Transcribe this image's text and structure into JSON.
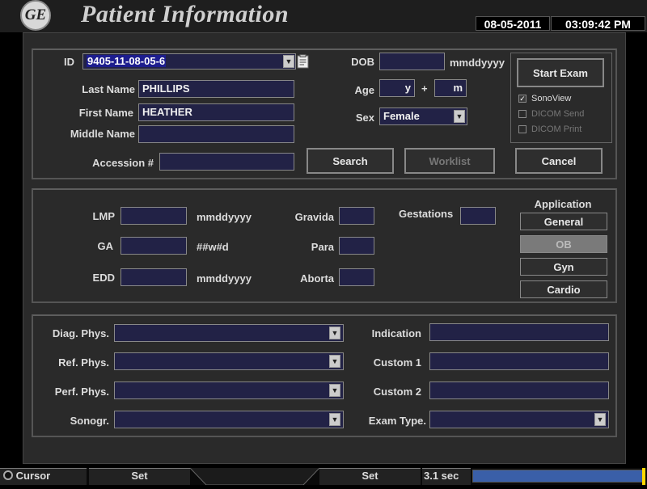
{
  "header": {
    "logo_text": "GE",
    "title": "Patient Information",
    "date": "08-05-2011",
    "time": "03:09:42 PM"
  },
  "patient": {
    "id_label": "ID",
    "id_value": "9405-11-08-05-6",
    "last_name_label": "Last Name",
    "last_name": "PHILLIPS",
    "first_name_label": "First Name",
    "first_name": "HEATHER",
    "middle_name_label": "Middle Name",
    "middle_name": "",
    "accession_label": "Accession #",
    "accession": "",
    "dob_label": "DOB",
    "dob": "",
    "dob_format": "mmddyyyy",
    "age_label": "Age",
    "age_years": "",
    "age_years_unit": "y",
    "age_plus": "+",
    "age_months": "",
    "age_months_unit": "m",
    "sex_label": "Sex",
    "sex_value": "Female"
  },
  "actions": {
    "start_exam": "Start Exam",
    "sonoview": "SonoView",
    "sonoview_checked": true,
    "dicom_send": "DICOM Send",
    "dicom_print": "DICOM Print",
    "search": "Search",
    "worklist": "Worklist",
    "cancel": "Cancel"
  },
  "ob": {
    "lmp_label": "LMP",
    "lmp": "",
    "lmp_format": "mmddyyyy",
    "ga_label": "GA",
    "ga": "",
    "ga_format": "##w#d",
    "edd_label": "EDD",
    "edd": "",
    "edd_format": "mmddyyyy",
    "gravida_label": "Gravida",
    "gravida": "",
    "para_label": "Para",
    "para": "",
    "aborta_label": "Aborta",
    "aborta": "",
    "gestations_label": "Gestations",
    "gestations": ""
  },
  "application": {
    "label": "Application",
    "items": [
      "General",
      "OB",
      "Gyn",
      "Cardio"
    ],
    "selected": "OB"
  },
  "physicians": {
    "diag_label": "Diag. Phys.",
    "diag": "",
    "ref_label": "Ref. Phys.",
    "ref": "",
    "perf_label": "Perf. Phys.",
    "perf": "",
    "sonogr_label": "Sonogr.",
    "sonogr": "",
    "indication_label": "Indication",
    "indication": "",
    "custom1_label": "Custom 1",
    "custom1": "",
    "custom2_label": "Custom 2",
    "custom2": "",
    "exam_type_label": "Exam Type.",
    "exam_type": ""
  },
  "footer": {
    "cursor": "Cursor",
    "set_left": "Set",
    "set_right": "Set",
    "time_value": "3.1 sec",
    "progress": 1.0
  },
  "colors": {
    "field_bg": "#222246",
    "selection": "#1d1d8e",
    "progress": "#3a5fa8"
  }
}
